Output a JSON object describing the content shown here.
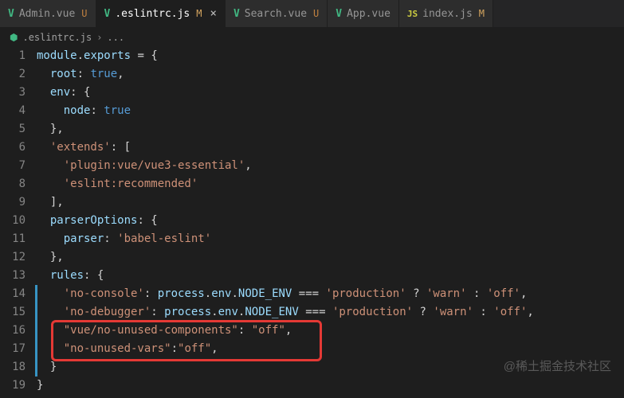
{
  "tabs": [
    {
      "icon": "vue",
      "name": "Admin.vue",
      "status": "U",
      "active": false
    },
    {
      "icon": "vue",
      "name": ".eslintrc.js",
      "status": "M",
      "active": true,
      "closeable": true
    },
    {
      "icon": "vue",
      "name": "Search.vue",
      "status": "U",
      "active": false
    },
    {
      "icon": "vue",
      "name": "App.vue",
      "status": "",
      "active": false
    },
    {
      "icon": "js",
      "name": "index.js",
      "status": "M",
      "active": false
    }
  ],
  "breadcrumb": {
    "icon": "vue",
    "file": ".eslintrc.js",
    "sep": "›",
    "trail": "..."
  },
  "lines": {
    "count": 19,
    "l1": {
      "a": "module",
      "b": ".",
      "c": "exports",
      "d": " = {"
    },
    "l2": {
      "a": "root",
      "b": ": ",
      "c": "true",
      "d": ","
    },
    "l3": {
      "a": "env",
      "b": ": {"
    },
    "l4": {
      "a": "node",
      "b": ": ",
      "c": "true"
    },
    "l5": {
      "a": "},"
    },
    "l6": {
      "a": "'extends'",
      "b": ": ["
    },
    "l7": {
      "a": "'plugin:vue/vue3-essential'",
      "b": ","
    },
    "l8": {
      "a": "'eslint:recommended'"
    },
    "l9": {
      "a": "],"
    },
    "l10": {
      "a": "parserOptions",
      "b": ": {"
    },
    "l11": {
      "a": "parser",
      "b": ": ",
      "c": "'babel-eslint'"
    },
    "l12": {
      "a": "},"
    },
    "l13": {
      "a": "rules",
      "b": ": {"
    },
    "l14": {
      "a": "'no-console'",
      "b": ": ",
      "c": "process",
      "d": ".",
      "e": "env",
      "f": ".",
      "g": "NODE_ENV",
      "h": " === ",
      "i": "'production'",
      "j": " ? ",
      "k": "'warn'",
      "l": " : ",
      "m": "'off'",
      "n": ","
    },
    "l15": {
      "a": "'no-debugger'",
      "b": ": ",
      "c": "process",
      "d": ".",
      "e": "env",
      "f": ".",
      "g": "NODE_ENV",
      "h": " === ",
      "i": "'production'",
      "j": " ? ",
      "k": "'warn'",
      "l": " : ",
      "m": "'off'",
      "n": ","
    },
    "l16": {
      "a": "\"vue/no-unused-components\"",
      "b": ": ",
      "c": "\"off\"",
      "d": ","
    },
    "l17": {
      "a": "\"no-unused-vars\"",
      "b": ":",
      "c": "\"off\"",
      "d": ","
    },
    "l18": {
      "a": "}"
    },
    "l19": {
      "a": "}"
    }
  },
  "watermark": "@稀土掘金技术社区"
}
